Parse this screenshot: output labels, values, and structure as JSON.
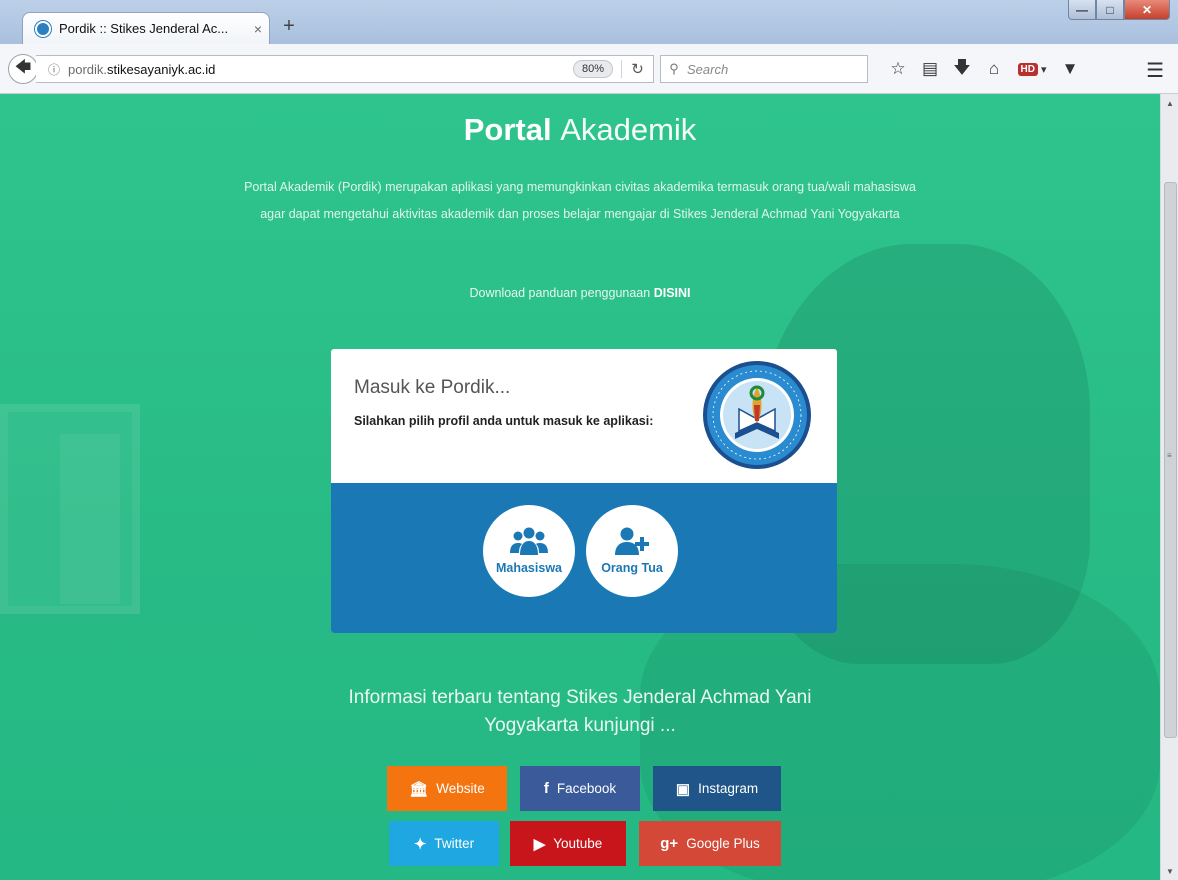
{
  "browser": {
    "tab_title": "Pordik :: Stikes Jenderal Ac...",
    "tab_close": "×",
    "new_tab": "+",
    "url_prefix": "pordik.",
    "url_domain": "stikesayaniyk.ac.id",
    "zoom": "80%",
    "search_placeholder": "Search",
    "hd_label": "HD"
  },
  "page": {
    "title_bold": "Portal",
    "title_light": "Akademik",
    "intro": "Portal Akademik (Pordik) merupakan aplikasi yang memungkinkan civitas akademika termasuk orang tua/wali mahasiswa agar dapat mengetahui aktivitas akademik dan proses belajar mengajar di Stikes Jenderal Achmad Yani Yogyakarta",
    "download_text": "Download panduan penggunaan",
    "download_link": "DISINI",
    "card": {
      "heading": "Masuk ke Pordik...",
      "subheading": "Silahkan pilih profil anda untuk masuk ke aplikasi:",
      "roles": [
        {
          "label": "Mahasiswa",
          "icon": "users-icon"
        },
        {
          "label": "Orang Tua",
          "icon": "user-plus-icon"
        }
      ]
    },
    "info_text": "Informasi terbaru tentang Stikes Jenderal Achmad Yani Yogyakarta kunjungi ...",
    "social": [
      {
        "label": "Website",
        "icon": "bank-icon",
        "color": "#f4740f"
      },
      {
        "label": "Facebook",
        "icon": "facebook-icon",
        "color": "#3b5a9a"
      },
      {
        "label": "Instagram",
        "icon": "instagram-icon",
        "color": "#1f5588"
      },
      {
        "label": "Twitter",
        "icon": "twitter-icon",
        "color": "#1ea7e0"
      },
      {
        "label": "Youtube",
        "icon": "youtube-icon",
        "color": "#c8151b"
      },
      {
        "label": "Google Plus",
        "icon": "google-plus-icon",
        "color": "#d34836"
      }
    ]
  },
  "colors": {
    "background": "#2fc48e",
    "card_blue": "#1a78b5"
  }
}
